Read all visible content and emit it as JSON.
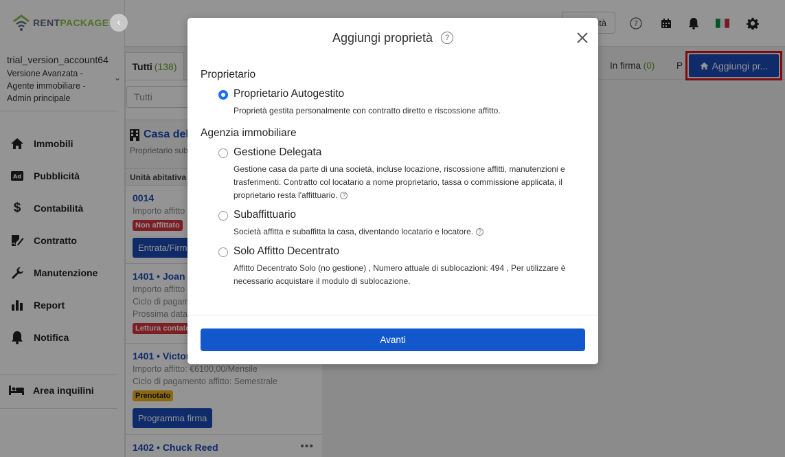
{
  "brand": {
    "part1": "RENT",
    "part2": "PACKAGE"
  },
  "account": {
    "name": "trial_version_account64",
    "line1": "Versione Avanzata -",
    "line2": "Agente immobiliare -",
    "line3": "Admin principale"
  },
  "nav": [
    {
      "label": "Immobili",
      "icon": "home-icon"
    },
    {
      "label": "Pubblicità",
      "icon": "ad-icon"
    },
    {
      "label": "Contabilità",
      "icon": "dollar-icon"
    },
    {
      "label": "Contratto",
      "icon": "contract-icon"
    },
    {
      "label": "Manutenzione",
      "icon": "wrench-icon"
    },
    {
      "label": "Report",
      "icon": "bar-chart-icon"
    },
    {
      "label": "Notifica",
      "icon": "bell-icon"
    }
  ],
  "tenant_area": "Area inquilini",
  "topbar": {
    "search_label": "ità"
  },
  "tabs": {
    "all_label": "Tutti",
    "all_count": "(138)",
    "signing_label": "In firma",
    "signing_count": "(0)",
    "partial_label": "P"
  },
  "add_property_label": "Aggiungi pr...",
  "filter_placeholder": "Tutti",
  "property": {
    "title": "Casa dell",
    "subtitle": "Proprietario sub"
  },
  "units_header": "Unità abitativa",
  "units": [
    {
      "title": "0014",
      "line1": "Importo affitto",
      "badge": "Non affittato",
      "button": "Entrata/Firma"
    },
    {
      "title": "1401 • Joan R",
      "line1": "Importo affitto",
      "line2": "Ciclo di pagamen",
      "line3": "Prossima data d",
      "badge": "Lettura contato"
    },
    {
      "title": "1401 • Victor",
      "line1": "Importo affitto: €6100,00/Mensile",
      "line2": "Ciclo di pagamento affitto: Semestrale",
      "badge": "Prenotato",
      "button": "Programma firma"
    },
    {
      "title": "1402 • Chuck Reed",
      "dots": "•••"
    }
  ],
  "modal": {
    "title": "Aggiungi proprietà",
    "help": "?",
    "section_owner": "Proprietario",
    "section_agency": "Agenzia immobiliare",
    "options": [
      {
        "label": "Proprietario Autogestito",
        "desc": "Proprietà gestita personalmente con contratto diretto e riscossione affitto."
      },
      {
        "label": "Gestione Delegata",
        "desc": "Gestione casa da parte di una società, incluse locazione, riscossione affitti, manutenzioni e trasferimenti. Contratto col locatario a nome proprietario, tassa o commissione applicata, il proprietario resta l'affittuario."
      },
      {
        "label": "Subaffittuario",
        "desc": "Società affitta e subaffitta la casa, diventando locatario e locatore."
      },
      {
        "label": "Solo Affitto Decentrato",
        "desc": "Affitto Decentrato Solo (no gestione) , Numero attuale di sublocazioni: 494 , Per utilizzare è necessario acquistare il modulo di sublocazione."
      }
    ],
    "next_label": "Avanti"
  },
  "colors": {
    "primary": "#1357cc",
    "brand_green": "#8cc04b",
    "highlight": "#d9141b"
  }
}
